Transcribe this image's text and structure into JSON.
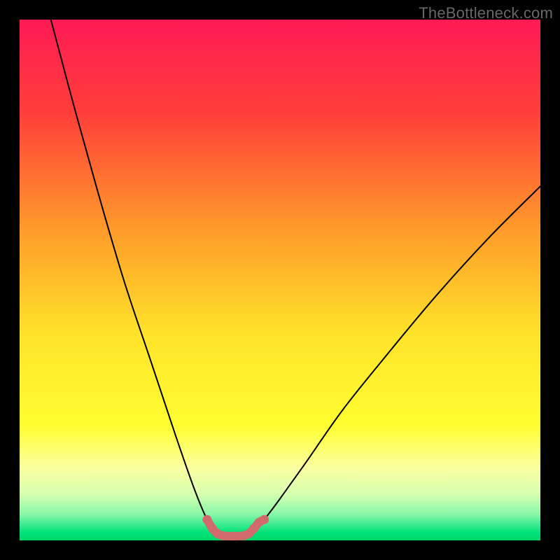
{
  "watermark": "TheBottleneck.com",
  "chart_data": {
    "type": "line",
    "title": "",
    "xlabel": "",
    "ylabel": "",
    "xlim": [
      0,
      100
    ],
    "ylim": [
      0,
      100
    ],
    "background_gradient": {
      "stops": [
        {
          "pos": 0.0,
          "color": "#ff1a54"
        },
        {
          "pos": 0.18,
          "color": "#ff3f3a"
        },
        {
          "pos": 0.4,
          "color": "#ff9a2a"
        },
        {
          "pos": 0.6,
          "color": "#ffe22a"
        },
        {
          "pos": 0.78,
          "color": "#ffff30"
        },
        {
          "pos": 0.86,
          "color": "#fbffa0"
        },
        {
          "pos": 0.91,
          "color": "#d8ffb0"
        },
        {
          "pos": 0.95,
          "color": "#88f7a8"
        },
        {
          "pos": 0.985,
          "color": "#00e27a"
        },
        {
          "pos": 1.0,
          "color": "#00d869"
        }
      ]
    },
    "series": [
      {
        "name": "bottleneck-curve-left",
        "color": "#000000",
        "x": [
          6,
          10,
          15,
          20,
          25,
          30,
          33.5,
          36.0,
          37.5
        ],
        "y": [
          100,
          85,
          67,
          50,
          35,
          20,
          10,
          4,
          2
        ]
      },
      {
        "name": "bottleneck-curve-right",
        "color": "#000000",
        "x": [
          45.5,
          47,
          50,
          55,
          62,
          70,
          80,
          90,
          100
        ],
        "y": [
          2,
          4,
          8,
          15,
          25,
          35,
          47,
          58,
          68
        ]
      },
      {
        "name": "optimal-band",
        "color": "#d16a6a",
        "x": [
          36.0,
          37.0,
          38.0,
          39.0,
          40.0,
          41.0,
          42.0,
          43.0,
          44.0,
          45.0,
          46.0,
          47.0
        ],
        "y": [
          4.0,
          2.3,
          1.3,
          0.9,
          0.8,
          0.8,
          0.8,
          0.9,
          1.3,
          2.3,
          3.5,
          4.0
        ]
      }
    ],
    "annotations": []
  }
}
